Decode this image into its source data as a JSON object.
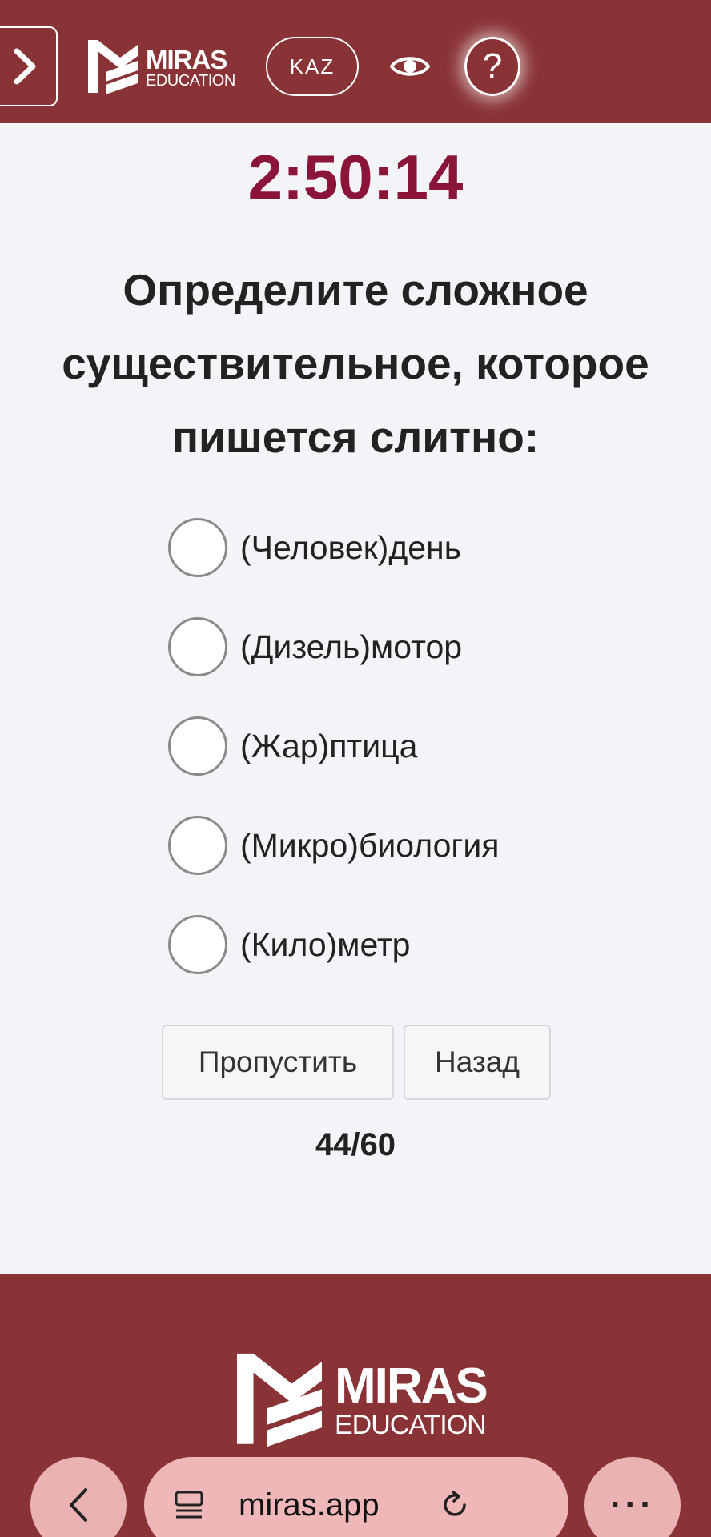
{
  "header": {
    "logo_primary": "MIRAS",
    "logo_secondary": "EDUCATION",
    "lang_label": "KAZ",
    "help_label": "?"
  },
  "timer": "2:50:14",
  "question": "Определите сложное существительное, которое пишется слитно:",
  "options": [
    {
      "label": "(Человек)день"
    },
    {
      "label": "(Дизель)мотор"
    },
    {
      "label": "(Жар)птица"
    },
    {
      "label": "(Микро)биология"
    },
    {
      "label": "(Кило)метр"
    }
  ],
  "buttons": {
    "skip": "Пропустить",
    "back": "Назад"
  },
  "progress": "44/60",
  "footer": {
    "logo_primary": "MIRAS",
    "logo_secondary": "EDUCATION"
  },
  "browser": {
    "url": "miras.app",
    "more_label": "···"
  },
  "colors": {
    "brand": "#8a3336",
    "timer": "#8a1538",
    "background": "#f3f4f8"
  },
  "icons": [
    "chevron-right-icon",
    "logo-icon",
    "eye-icon",
    "help-icon",
    "chevron-left-icon",
    "reader-icon",
    "reload-icon"
  ]
}
